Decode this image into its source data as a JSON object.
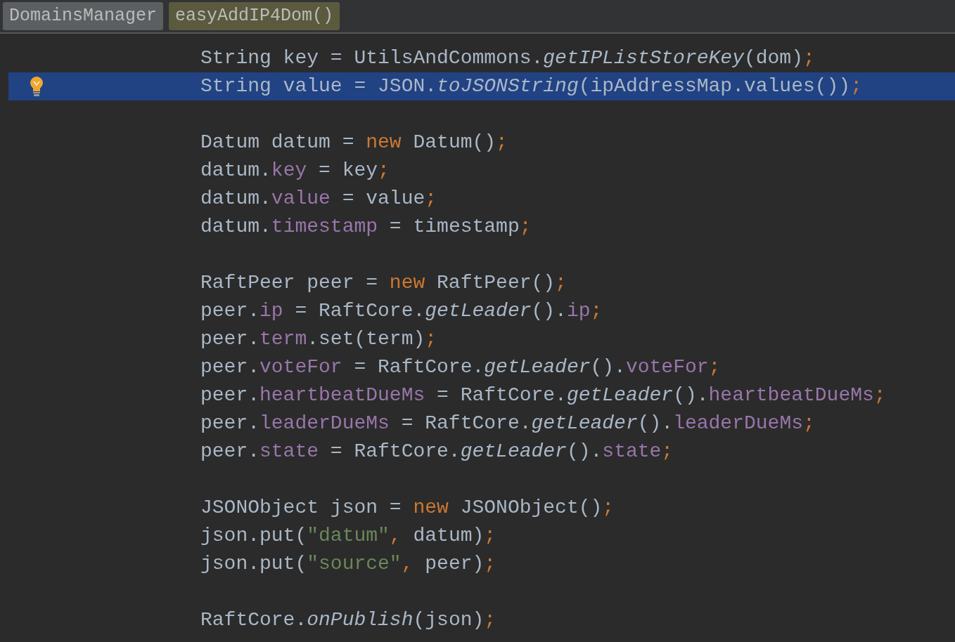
{
  "breadcrumbs": [
    {
      "label": "DomainsManager",
      "kind": "class"
    },
    {
      "label": "easyAddIP4Dom()",
      "kind": "method"
    }
  ],
  "lines": [
    {
      "kind": "code",
      "selected": false,
      "bulb": false,
      "tokens": [
        {
          "kind": "plain",
          "text": "String key = UtilsAndCommons."
        },
        {
          "kind": "static",
          "text": "getIPListStoreKey"
        },
        {
          "kind": "plain",
          "text": "(dom)"
        },
        {
          "kind": "keyword",
          "text": ";"
        }
      ]
    },
    {
      "kind": "code",
      "selected": true,
      "bulb": true,
      "tokens": [
        {
          "kind": "plain",
          "text": "String value = JSON."
        },
        {
          "kind": "static",
          "text": "toJSONString"
        },
        {
          "kind": "plain",
          "text": "(ipAddressMap.values())"
        },
        {
          "kind": "keyword",
          "text": ";"
        }
      ]
    },
    {
      "kind": "blank",
      "selected": false,
      "bulb": false
    },
    {
      "kind": "code",
      "selected": false,
      "bulb": false,
      "tokens": [
        {
          "kind": "plain",
          "text": "Datum datum = "
        },
        {
          "kind": "keyword",
          "text": "new"
        },
        {
          "kind": "plain",
          "text": " Datum()"
        },
        {
          "kind": "keyword",
          "text": ";"
        }
      ]
    },
    {
      "kind": "code",
      "selected": false,
      "bulb": false,
      "tokens": [
        {
          "kind": "plain",
          "text": "datum."
        },
        {
          "kind": "field",
          "text": "key"
        },
        {
          "kind": "plain",
          "text": " = key"
        },
        {
          "kind": "keyword",
          "text": ";"
        }
      ]
    },
    {
      "kind": "code",
      "selected": false,
      "bulb": false,
      "tokens": [
        {
          "kind": "plain",
          "text": "datum."
        },
        {
          "kind": "field",
          "text": "value"
        },
        {
          "kind": "plain",
          "text": " = value"
        },
        {
          "kind": "keyword",
          "text": ";"
        }
      ]
    },
    {
      "kind": "code",
      "selected": false,
      "bulb": false,
      "tokens": [
        {
          "kind": "plain",
          "text": "datum."
        },
        {
          "kind": "field",
          "text": "timestamp"
        },
        {
          "kind": "plain",
          "text": " = timestamp"
        },
        {
          "kind": "keyword",
          "text": ";"
        }
      ]
    },
    {
      "kind": "blank",
      "selected": false,
      "bulb": false
    },
    {
      "kind": "code",
      "selected": false,
      "bulb": false,
      "tokens": [
        {
          "kind": "plain",
          "text": "RaftPeer peer = "
        },
        {
          "kind": "keyword",
          "text": "new"
        },
        {
          "kind": "plain",
          "text": " RaftPeer()"
        },
        {
          "kind": "keyword",
          "text": ";"
        }
      ]
    },
    {
      "kind": "code",
      "selected": false,
      "bulb": false,
      "tokens": [
        {
          "kind": "plain",
          "text": "peer."
        },
        {
          "kind": "field",
          "text": "ip"
        },
        {
          "kind": "plain",
          "text": " = RaftCore."
        },
        {
          "kind": "static",
          "text": "getLeader"
        },
        {
          "kind": "plain",
          "text": "()."
        },
        {
          "kind": "field",
          "text": "ip"
        },
        {
          "kind": "keyword",
          "text": ";"
        }
      ]
    },
    {
      "kind": "code",
      "selected": false,
      "bulb": false,
      "tokens": [
        {
          "kind": "plain",
          "text": "peer."
        },
        {
          "kind": "field",
          "text": "term"
        },
        {
          "kind": "plain",
          "text": ".set(term)"
        },
        {
          "kind": "keyword",
          "text": ";"
        }
      ]
    },
    {
      "kind": "code",
      "selected": false,
      "bulb": false,
      "tokens": [
        {
          "kind": "plain",
          "text": "peer."
        },
        {
          "kind": "field",
          "text": "voteFor"
        },
        {
          "kind": "plain",
          "text": " = RaftCore."
        },
        {
          "kind": "static",
          "text": "getLeader"
        },
        {
          "kind": "plain",
          "text": "()."
        },
        {
          "kind": "field",
          "text": "voteFor"
        },
        {
          "kind": "keyword",
          "text": ";"
        }
      ]
    },
    {
      "kind": "code",
      "selected": false,
      "bulb": false,
      "tokens": [
        {
          "kind": "plain",
          "text": "peer."
        },
        {
          "kind": "field",
          "text": "heartbeatDueMs"
        },
        {
          "kind": "plain",
          "text": " = RaftCore."
        },
        {
          "kind": "static",
          "text": "getLeader"
        },
        {
          "kind": "plain",
          "text": "()."
        },
        {
          "kind": "field",
          "text": "heartbeatDueMs"
        },
        {
          "kind": "keyword",
          "text": ";"
        }
      ]
    },
    {
      "kind": "code",
      "selected": false,
      "bulb": false,
      "tokens": [
        {
          "kind": "plain",
          "text": "peer."
        },
        {
          "kind": "field",
          "text": "leaderDueMs"
        },
        {
          "kind": "plain",
          "text": " = RaftCore."
        },
        {
          "kind": "static",
          "text": "getLeader"
        },
        {
          "kind": "plain",
          "text": "()."
        },
        {
          "kind": "field",
          "text": "leaderDueMs"
        },
        {
          "kind": "keyword",
          "text": ";"
        }
      ]
    },
    {
      "kind": "code",
      "selected": false,
      "bulb": false,
      "tokens": [
        {
          "kind": "plain",
          "text": "peer."
        },
        {
          "kind": "field",
          "text": "state"
        },
        {
          "kind": "plain",
          "text": " = RaftCore."
        },
        {
          "kind": "static",
          "text": "getLeader"
        },
        {
          "kind": "plain",
          "text": "()."
        },
        {
          "kind": "field",
          "text": "state"
        },
        {
          "kind": "keyword",
          "text": ";"
        }
      ]
    },
    {
      "kind": "blank",
      "selected": false,
      "bulb": false
    },
    {
      "kind": "code",
      "selected": false,
      "bulb": false,
      "tokens": [
        {
          "kind": "plain",
          "text": "JSONObject json = "
        },
        {
          "kind": "keyword",
          "text": "new"
        },
        {
          "kind": "plain",
          "text": " JSONObject()"
        },
        {
          "kind": "keyword",
          "text": ";"
        }
      ]
    },
    {
      "kind": "code",
      "selected": false,
      "bulb": false,
      "tokens": [
        {
          "kind": "plain",
          "text": "json.put("
        },
        {
          "kind": "string",
          "text": "\"datum\""
        },
        {
          "kind": "keyword",
          "text": ","
        },
        {
          "kind": "plain",
          "text": " datum)"
        },
        {
          "kind": "keyword",
          "text": ";"
        }
      ]
    },
    {
      "kind": "code",
      "selected": false,
      "bulb": false,
      "tokens": [
        {
          "kind": "plain",
          "text": "json.put("
        },
        {
          "kind": "string",
          "text": "\"source\""
        },
        {
          "kind": "keyword",
          "text": ","
        },
        {
          "kind": "plain",
          "text": " peer)"
        },
        {
          "kind": "keyword",
          "text": ";"
        }
      ]
    },
    {
      "kind": "blank",
      "selected": false,
      "bulb": false
    },
    {
      "kind": "code",
      "selected": false,
      "bulb": false,
      "tokens": [
        {
          "kind": "plain",
          "text": "RaftCore."
        },
        {
          "kind": "static",
          "text": "onPublish"
        },
        {
          "kind": "plain",
          "text": "(json)"
        },
        {
          "kind": "keyword",
          "text": ";"
        }
      ]
    }
  ]
}
